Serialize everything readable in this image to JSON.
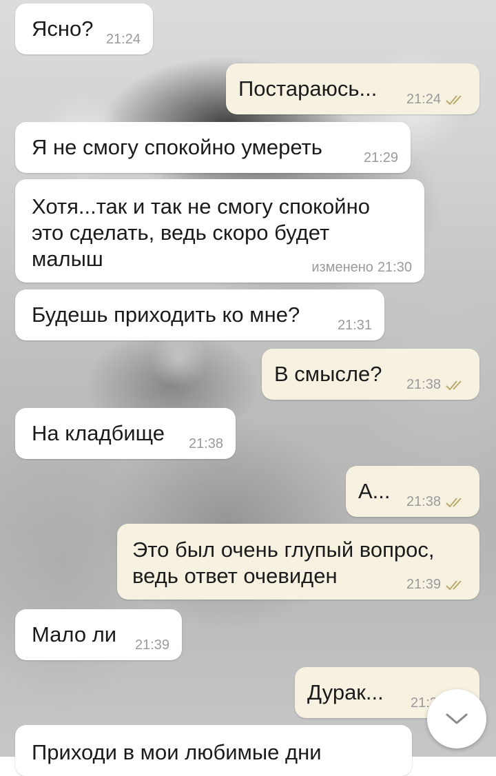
{
  "messages": [
    {
      "text": "Ясно?",
      "time": "21:24",
      "direction": "incoming"
    },
    {
      "text": "Постараюсь...",
      "time": "21:24",
      "direction": "outgoing",
      "read": true
    },
    {
      "text": "Я не смогу спокойно умереть",
      "time": "21:29",
      "direction": "incoming"
    },
    {
      "lines": [
        "Хотя...так и так не смогу спокойно",
        "это сделать, ведь скоро будет",
        "малыш"
      ],
      "edited_label": "изменено",
      "time": "21:30",
      "direction": "incoming"
    },
    {
      "text": "Будешь приходить ко мне?",
      "time": "21:31",
      "direction": "incoming"
    },
    {
      "text": "В смысле?",
      "time": "21:38",
      "direction": "outgoing",
      "read": true
    },
    {
      "text": "На кладбище",
      "time": "21:38",
      "direction": "incoming"
    },
    {
      "text": "А...",
      "time": "21:38",
      "direction": "outgoing",
      "read": true
    },
    {
      "lines": [
        "Это был очень глупый вопрос,",
        "ведь ответ очевиден"
      ],
      "time": "21:39",
      "direction": "outgoing",
      "read": true
    },
    {
      "text": "Мало ли",
      "time": "21:39",
      "direction": "incoming"
    },
    {
      "text": "Дурак...",
      "time": "21:3",
      "direction": "outgoing"
    },
    {
      "text": "Приходи в мои любимые дни",
      "time": "",
      "direction": "incoming"
    }
  ],
  "colors": {
    "incoming_bubble": "#ffffff",
    "outgoing_bubble": "#f6f1e0",
    "text": "#1b1b1b",
    "timestamp": "#9a9a9a",
    "read_checks": "#b9a86a"
  },
  "icons": {
    "read_receipt": "double-check-icon",
    "scroll_down": "chevron-down-icon"
  }
}
